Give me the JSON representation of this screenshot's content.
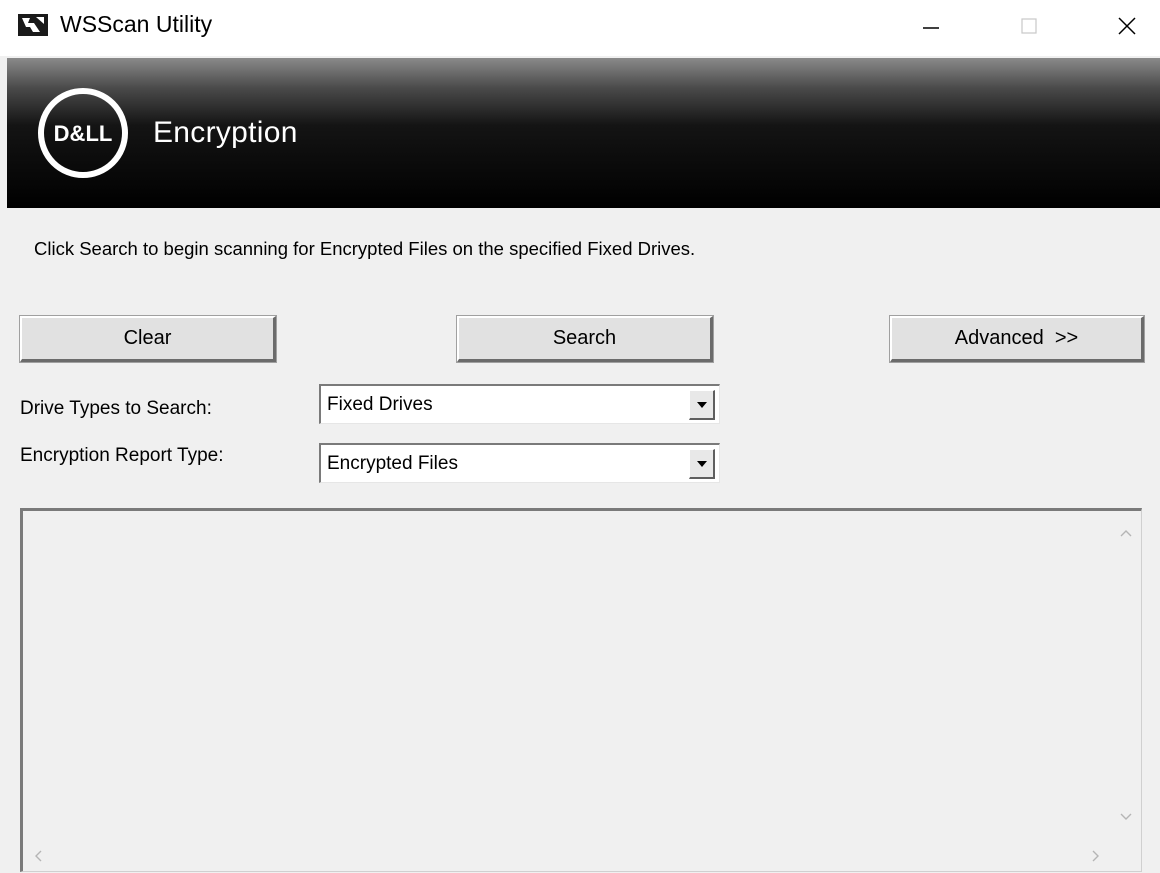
{
  "window": {
    "title": "WSScan Utility",
    "app_icon": "wsscan-app-icon",
    "controls": {
      "minimize_icon": "minimize-icon",
      "maximize_icon": "maximize-icon",
      "close_icon": "close-icon"
    }
  },
  "banner": {
    "logo_text": "D&LL",
    "logo_icon": "dell-logo",
    "title": "Encryption"
  },
  "main": {
    "instruction": "Click Search to begin scanning for Encrypted Files on the specified Fixed Drives.",
    "buttons": {
      "clear": "Clear",
      "search": "Search",
      "advanced": "Advanced  >>"
    },
    "fields": {
      "drive_types_label": "Drive Types to Search:",
      "drive_types_value": "Fixed Drives",
      "report_type_label": "Encryption Report Type:",
      "report_type_value": "Encrypted Files"
    }
  },
  "colors": {
    "window_bg": "#f0f0f0",
    "banner_bg": "#000000",
    "banner_text": "#ffffff",
    "button_bg": "#e1e1e1"
  }
}
